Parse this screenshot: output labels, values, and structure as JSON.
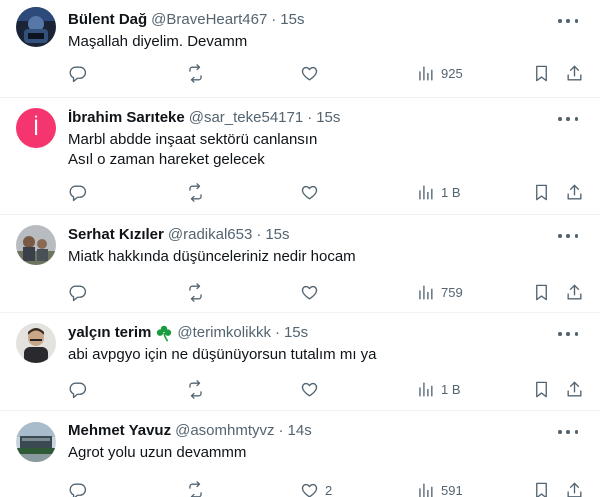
{
  "tweets": [
    {
      "name": "Bülent Dağ",
      "handle": "@BraveHeart467",
      "time": "15s",
      "text": "Maşallah diyelim. Devamm",
      "views": "925",
      "likes": "",
      "retweets": "",
      "replies": "",
      "badge_icon": "",
      "avatar": "photo-dark-blue"
    },
    {
      "name": "İbrahim Sarıteke",
      "handle": "@sar_teke54171",
      "time": "15s",
      "text": "Marbl abdde inşaat sektörü canlansın\nAsıl o zaman hareket gelecek",
      "views": "1 B",
      "likes": "",
      "retweets": "",
      "replies": "",
      "badge_icon": "",
      "avatar": "initial-pink",
      "avatar_initial": "İ"
    },
    {
      "name": "Serhat Kızıler",
      "handle": "@radikal653",
      "time": "15s",
      "text": "Miatk hakkında düşünceleriniz nedir hocam",
      "views": "759",
      "likes": "",
      "retweets": "",
      "replies": "",
      "badge_icon": "",
      "avatar": "photo-group"
    },
    {
      "name": "yalçın terim",
      "handle": "@terimkolikkk",
      "time": "15s",
      "text": "abi avpgyo için ne düşünüyorsun tutalım mı ya",
      "views": "1 B",
      "likes": "",
      "retweets": "",
      "replies": "",
      "badge_icon": "shamrock-icon",
      "avatar": "photo-portrait"
    },
    {
      "name": "Mehmet Yavuz",
      "handle": "@asomhmtyvz",
      "time": "14s",
      "text": "Agrot yolu uzun devammm",
      "views": "591",
      "likes": "2",
      "retweets": "",
      "replies": "",
      "badge_icon": "",
      "avatar": "photo-building"
    }
  ],
  "colors": {
    "text": "#0f1419",
    "secondary": "#536471",
    "divider": "#eff3f4",
    "shamrock": "#1a9c3e",
    "pink_avatar": "#f4356e"
  }
}
